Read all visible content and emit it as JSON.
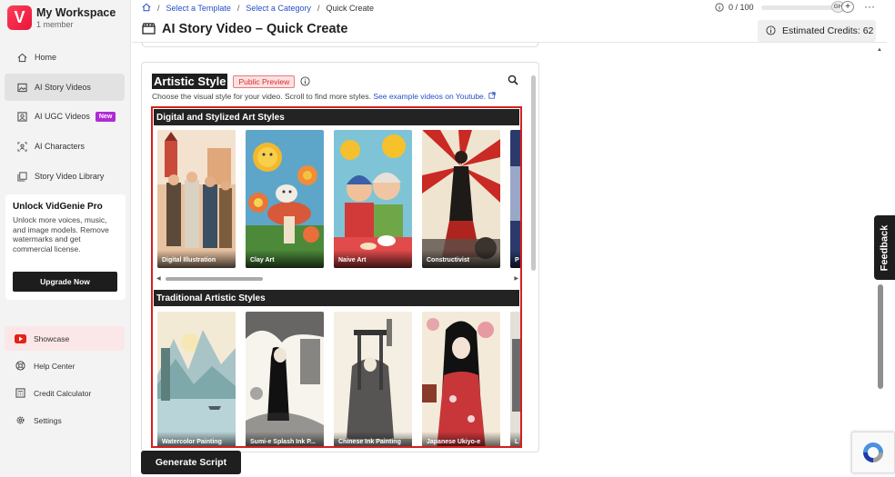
{
  "workspace": {
    "name": "My Workspace",
    "members": "1 member",
    "logo_letter": "V"
  },
  "sidebar": {
    "items": [
      {
        "label": "Home",
        "icon": "home-icon"
      },
      {
        "label": "AI Story Videos",
        "icon": "image-icon"
      },
      {
        "label": "AI UGC Videos",
        "icon": "user-video-icon",
        "badge": "New"
      },
      {
        "label": "AI Characters",
        "icon": "character-icon"
      },
      {
        "label": "Story Video Library",
        "icon": "library-icon"
      }
    ],
    "promo": {
      "title": "Unlock VidGenie Pro",
      "body": "Unlock more voices, music, and image models. Remove watermarks and get commercial license.",
      "button": "Upgrade Now"
    },
    "bottom_items": [
      {
        "label": "Showcase",
        "icon": "youtube-icon"
      },
      {
        "label": "Help Center",
        "icon": "lifebuoy-icon"
      },
      {
        "label": "Credit Calculator",
        "icon": "calculator-icon"
      },
      {
        "label": "Settings",
        "icon": "gear-icon"
      }
    ]
  },
  "breadcrumb": {
    "home_icon": "home-icon",
    "items": [
      "Select a Template",
      "Select a Category",
      "Quick Create"
    ],
    "separator": "/"
  },
  "usage": {
    "text": "0 / 100",
    "progress": 0
  },
  "user": {
    "initials": "GH"
  },
  "header": {
    "title": "AI Story Video – Quick Create",
    "credits": "Estimated Credits: 62"
  },
  "panel": {
    "title": "Artistic Style",
    "badge": "Public Preview",
    "description": "Choose the visual style for your video. Scroll to find more styles.",
    "link": "See example videos on Youtube.",
    "sections": [
      {
        "title": "Digital and Stylized Art Styles",
        "cards": [
          "Digital Illustration",
          "Clay Art",
          "Naive Art",
          "Constructivist",
          "P"
        ],
        "scroll_position": 0
      },
      {
        "title": "Traditional Artistic Styles",
        "cards": [
          "Watercolor Painting",
          "Sumi-e Splash Ink P...",
          "Chinese Ink Painting",
          "Japanese Ukiyo-e",
          "L"
        ]
      }
    ]
  },
  "actions": {
    "generate": "Generate Script"
  },
  "feedback": "Feedback",
  "colors": {
    "accent_red": "#d42020",
    "brand": "#e8153a",
    "link": "#2450c8",
    "dark": "#1e1e1e"
  }
}
